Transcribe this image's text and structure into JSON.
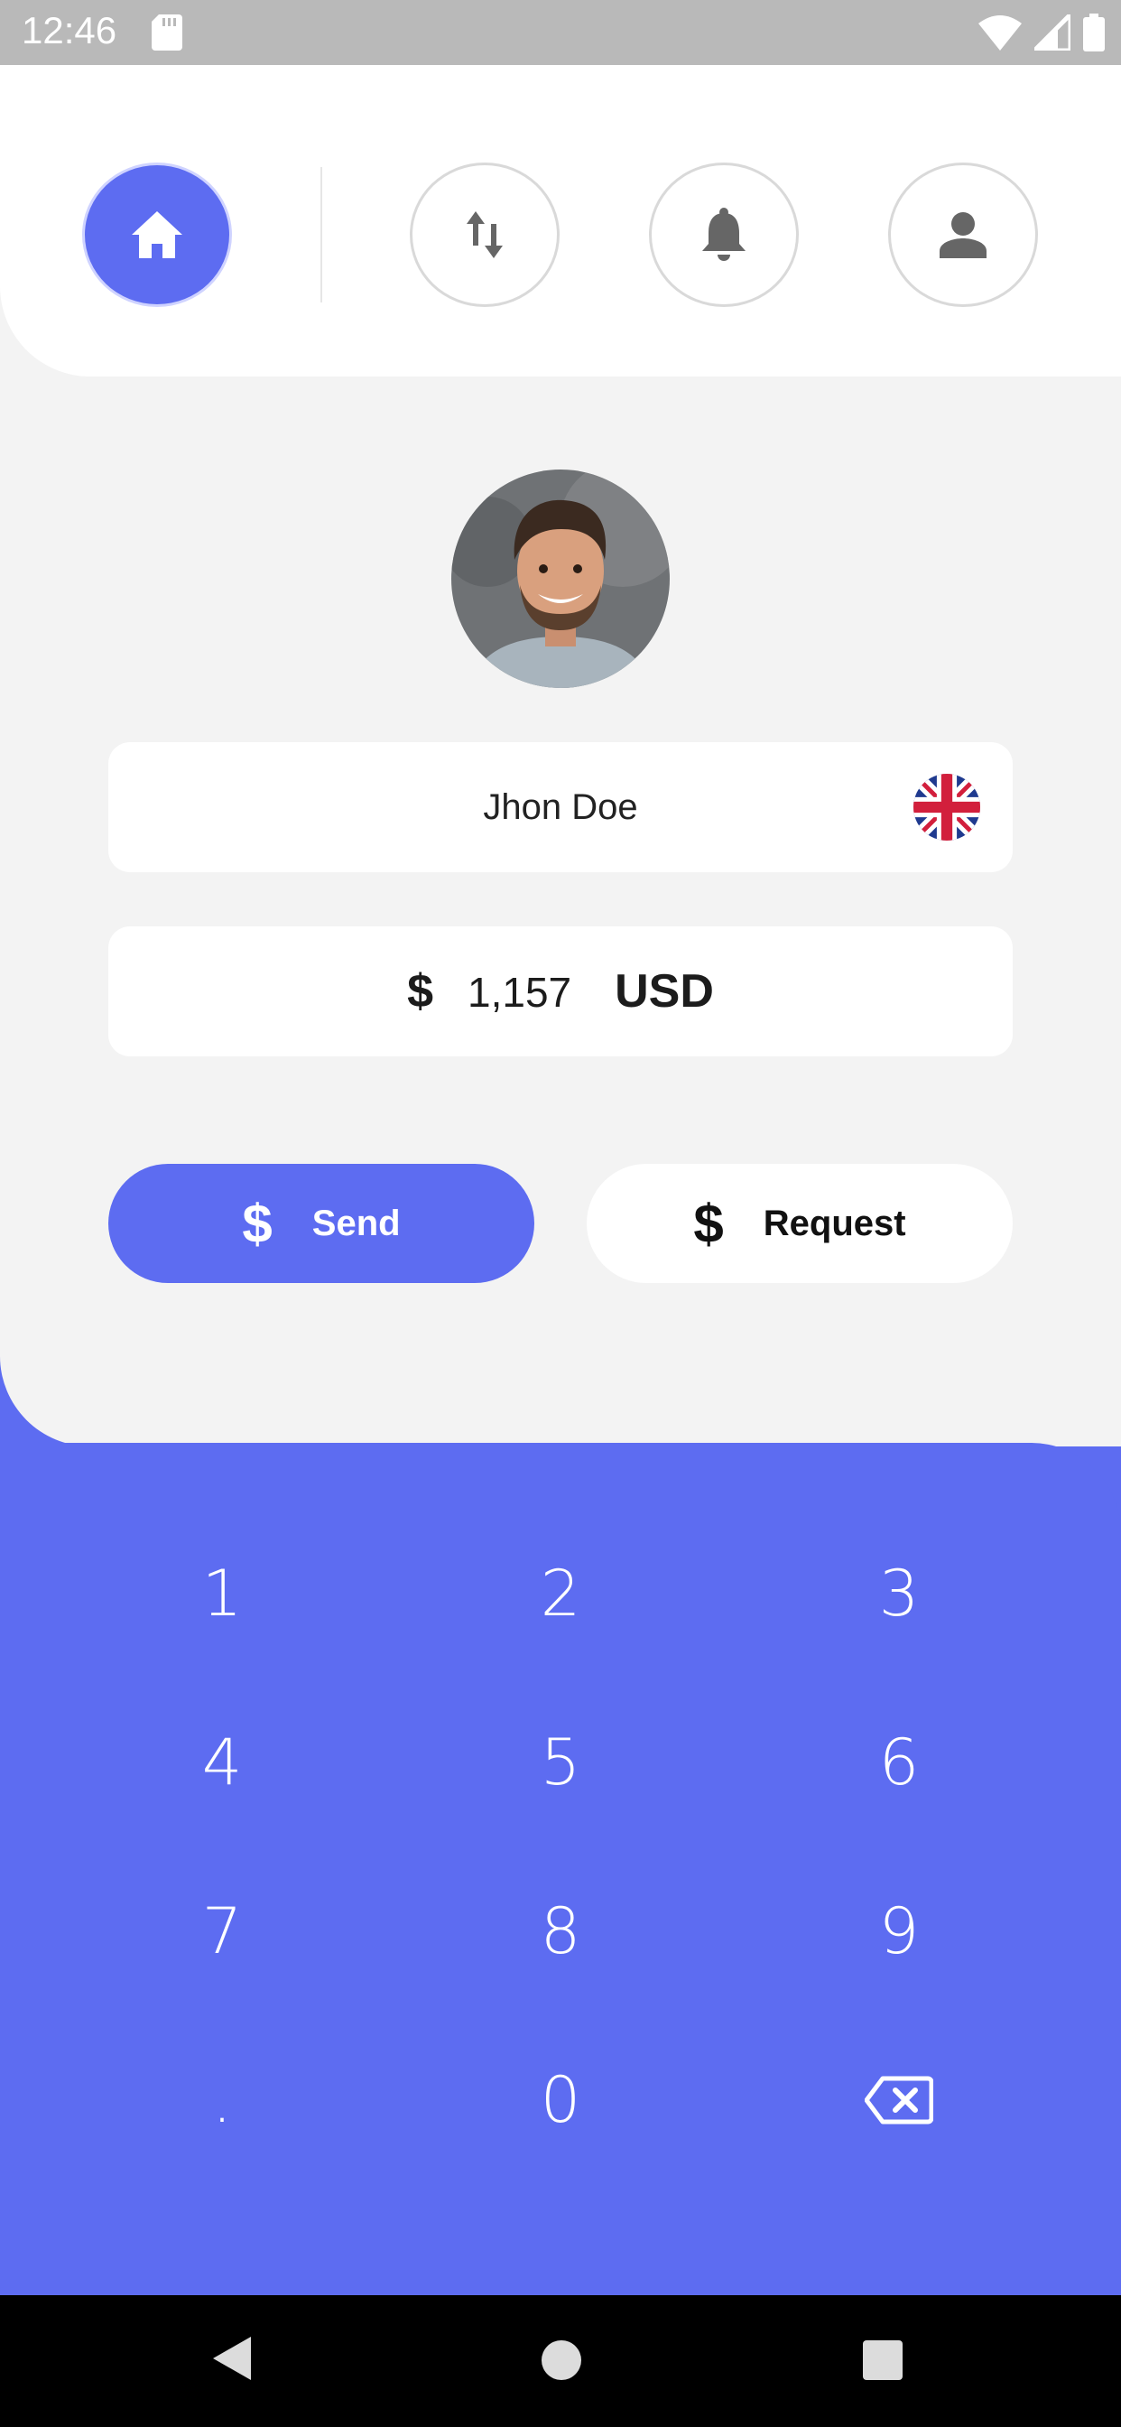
{
  "status_bar": {
    "time": "12:46"
  },
  "colors": {
    "accent": "#5d6cf1",
    "panel": "#f3f3f3",
    "card": "#ffffff"
  },
  "top_nav": {
    "items": [
      {
        "icon": "home-icon",
        "active": true
      },
      {
        "icon": "transfer-icon",
        "active": false
      },
      {
        "icon": "bell-icon",
        "active": false
      },
      {
        "icon": "person-icon",
        "active": false
      }
    ]
  },
  "recipient": {
    "name": "Jhon Doe",
    "flag": "uk-flag-icon"
  },
  "balance": {
    "symbol": "$",
    "amount": "1,157",
    "currency": "USD"
  },
  "actions": {
    "send": {
      "symbol": "$",
      "label": "Send"
    },
    "request": {
      "symbol": "$",
      "label": "Request"
    }
  },
  "keypad": {
    "keys": [
      "1",
      "2",
      "3",
      "4",
      "5",
      "6",
      "7",
      "8",
      "9",
      ".",
      "0"
    ]
  }
}
